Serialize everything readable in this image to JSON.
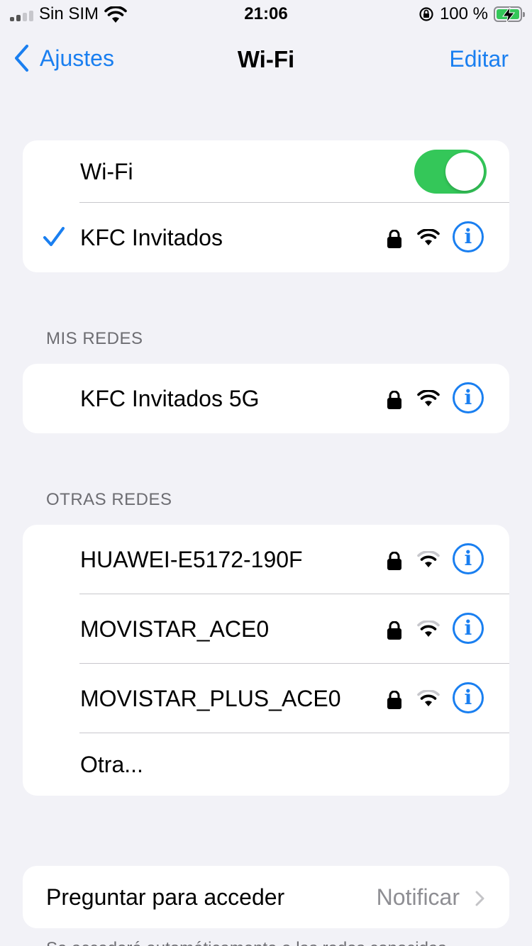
{
  "status_bar": {
    "carrier": "Sin SIM",
    "time": "21:06",
    "battery": "100 %"
  },
  "nav": {
    "back_label": "Ajustes",
    "title": "Wi-Fi",
    "edit_label": "Editar"
  },
  "wifi_group": {
    "toggle_label": "Wi-Fi",
    "toggle_on": true,
    "connected_network": "KFC Invitados"
  },
  "my_networks": {
    "header": "MIS REDES",
    "items": [
      {
        "name": "KFC Invitados 5G",
        "locked": true,
        "signal": "full"
      }
    ]
  },
  "other_networks": {
    "header": "OTRAS REDES",
    "items": [
      {
        "name": "HUAWEI-E5172-190F",
        "locked": true,
        "signal": "medium"
      },
      {
        "name": "MOVISTAR_ACE0",
        "locked": true,
        "signal": "medium"
      },
      {
        "name": "MOVISTAR_PLUS_ACE0",
        "locked": true,
        "signal": "medium"
      }
    ],
    "other_label": "Otra..."
  },
  "ask_join": {
    "label": "Preguntar para acceder",
    "value": "Notificar"
  },
  "footer": {
    "text": "Se accederá automáticamente a las redes conocidas."
  },
  "colors": {
    "accent": "#1a7ff0",
    "toggle_on": "#34c759",
    "background": "#f2f2f7"
  }
}
